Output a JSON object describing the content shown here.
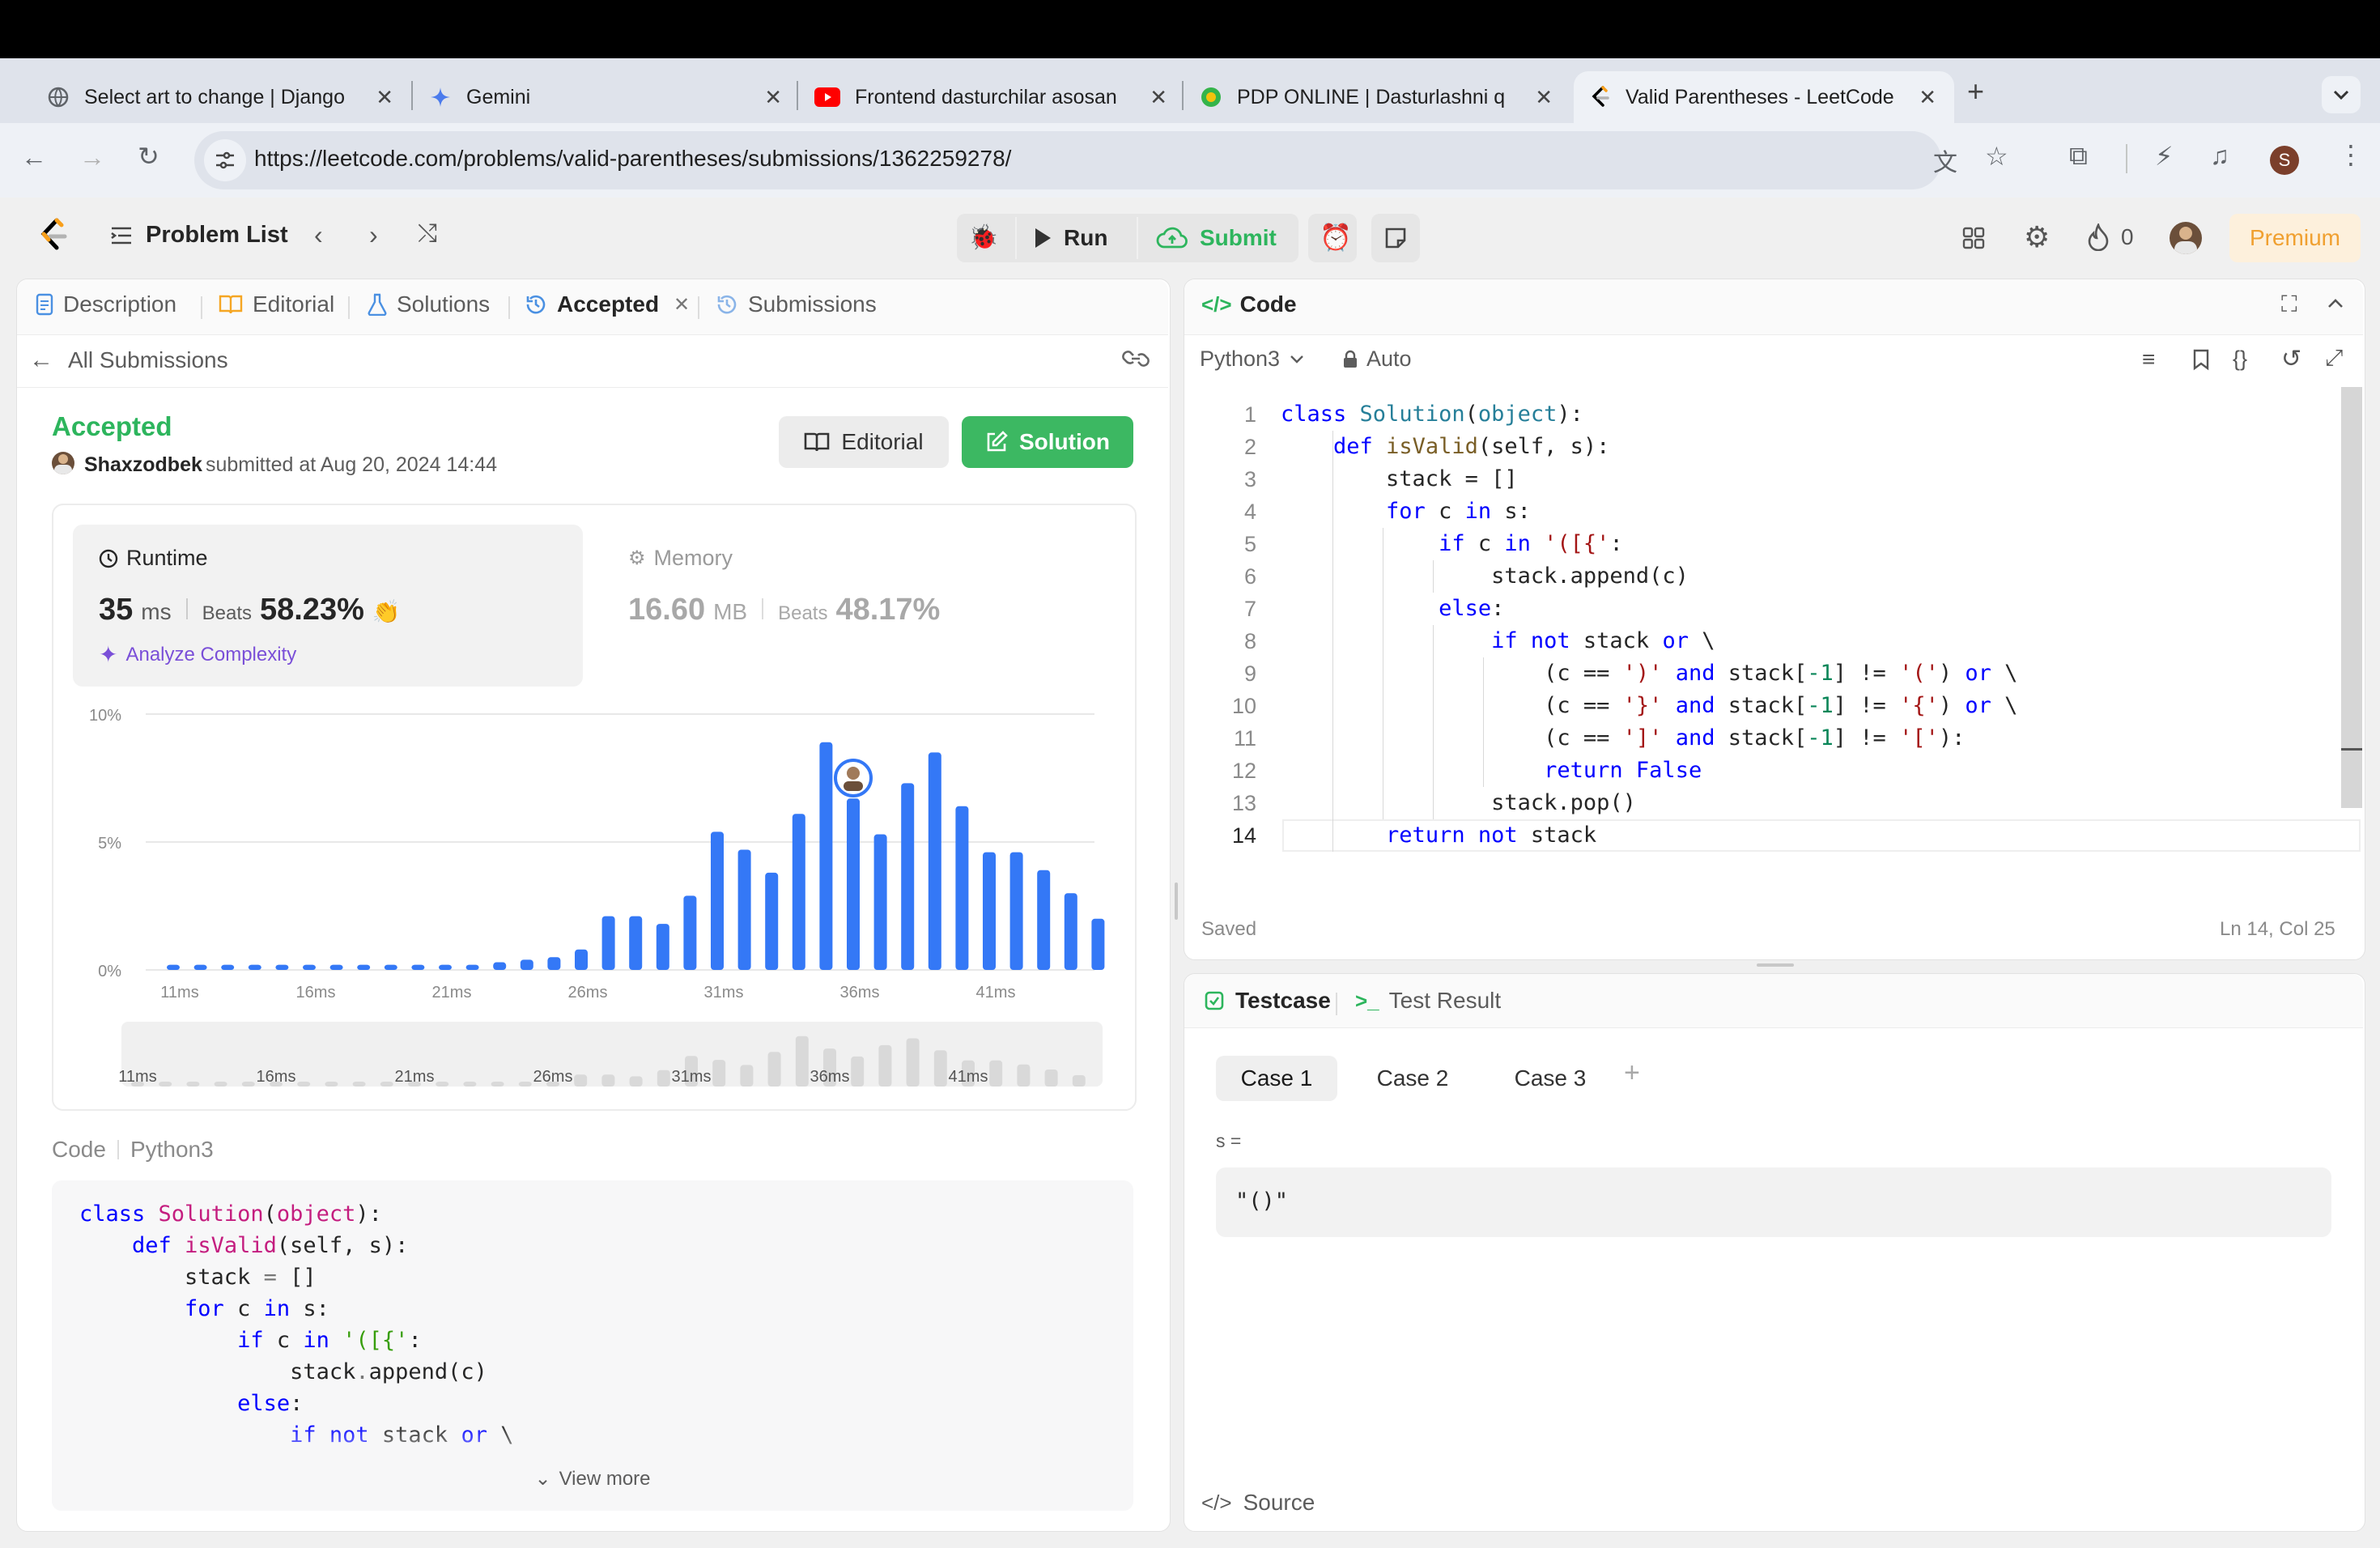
{
  "browser": {
    "tabs": [
      {
        "title": "Select art to change | Django",
        "icon": "globe-icon"
      },
      {
        "title": "Gemini",
        "icon": "gemini-icon"
      },
      {
        "title": "Frontend dasturchilar asosan",
        "icon": "youtube-icon"
      },
      {
        "title": "PDP ONLINE | Dasturlashni qu",
        "icon": "pdp-icon"
      },
      {
        "title": "Valid Parentheses - LeetCode",
        "icon": "leetcode-icon",
        "active": true
      }
    ],
    "url": "https://leetcode.com/problems/valid-parentheses/submissions/1362259278/",
    "profile_initial": "S"
  },
  "header": {
    "problem_list": "Problem List",
    "run": "Run",
    "submit": "Submit",
    "streak": "0",
    "premium": "Premium"
  },
  "left_tabs": {
    "description": "Description",
    "editorial": "Editorial",
    "solutions": "Solutions",
    "accepted": "Accepted",
    "submissions": "Submissions"
  },
  "submission": {
    "back_label": "All Submissions",
    "status": "Accepted",
    "user": "Shaxzodbek",
    "submitted_text": "submitted at Aug 20, 2024 14:44",
    "editorial_btn": "Editorial",
    "solution_btn": "Solution",
    "runtime_label": "Runtime",
    "runtime_value": "35",
    "runtime_unit": "ms",
    "beats_label": "Beats",
    "runtime_beats": "58.23%",
    "analyze": "Analyze Complexity",
    "memory_label": "Memory",
    "memory_value": "16.60",
    "memory_unit": "MB",
    "memory_beats": "48.17%",
    "code_label": "Code",
    "code_lang": "Python3",
    "view_more": "View more"
  },
  "chart_data": {
    "type": "bar",
    "y_ticks": [
      "10%",
      "5%",
      "0%"
    ],
    "ylim": [
      0,
      10
    ],
    "x_ticks": [
      "11ms",
      "16ms",
      "21ms",
      "26ms",
      "31ms",
      "36ms",
      "41ms"
    ],
    "x_tick_index": [
      0,
      5,
      10,
      15,
      20,
      25,
      30
    ],
    "values": [
      0.2,
      0.2,
      0.2,
      0.2,
      0.2,
      0.2,
      0.2,
      0.2,
      0.2,
      0.2,
      0.2,
      0.2,
      0.3,
      0.4,
      0.5,
      0.8,
      2.1,
      2.1,
      1.8,
      2.9,
      5.4,
      4.7,
      3.8,
      6.1,
      8.9,
      6.7,
      5.3,
      7.3,
      8.5,
      6.4,
      4.6,
      4.6,
      3.9,
      3.0,
      2.0
    ],
    "highlight_index": 25,
    "grid": true,
    "brush_values": [
      0.2,
      0.2,
      0.2,
      0.2,
      0.2,
      0.2,
      0.2,
      0.2,
      0.2,
      0.2,
      0.2,
      0.2,
      0.3,
      0.4,
      0.5,
      0.8,
      2.1,
      2.1,
      1.8,
      2.9,
      5.4,
      4.7,
      3.8,
      6.1,
      8.9,
      6.7,
      5.3,
      7.3,
      8.5,
      6.4,
      4.6,
      4.6,
      3.9,
      3.0,
      2.0
    ]
  },
  "editor": {
    "title": "Code",
    "language": "Python3",
    "auto": "Auto",
    "saved": "Saved",
    "cursor": "Ln 14, Col 25",
    "line_numbers": [
      "1",
      "2",
      "3",
      "4",
      "5",
      "6",
      "7",
      "8",
      "9",
      "10",
      "11",
      "12",
      "13",
      "14"
    ]
  },
  "testcase": {
    "tab": "Testcase",
    "result_tab": "Test Result",
    "cases": [
      "Case 1",
      "Case 2",
      "Case 3"
    ],
    "var_label": "s =",
    "var_value": "\"()\"",
    "source": "Source"
  }
}
